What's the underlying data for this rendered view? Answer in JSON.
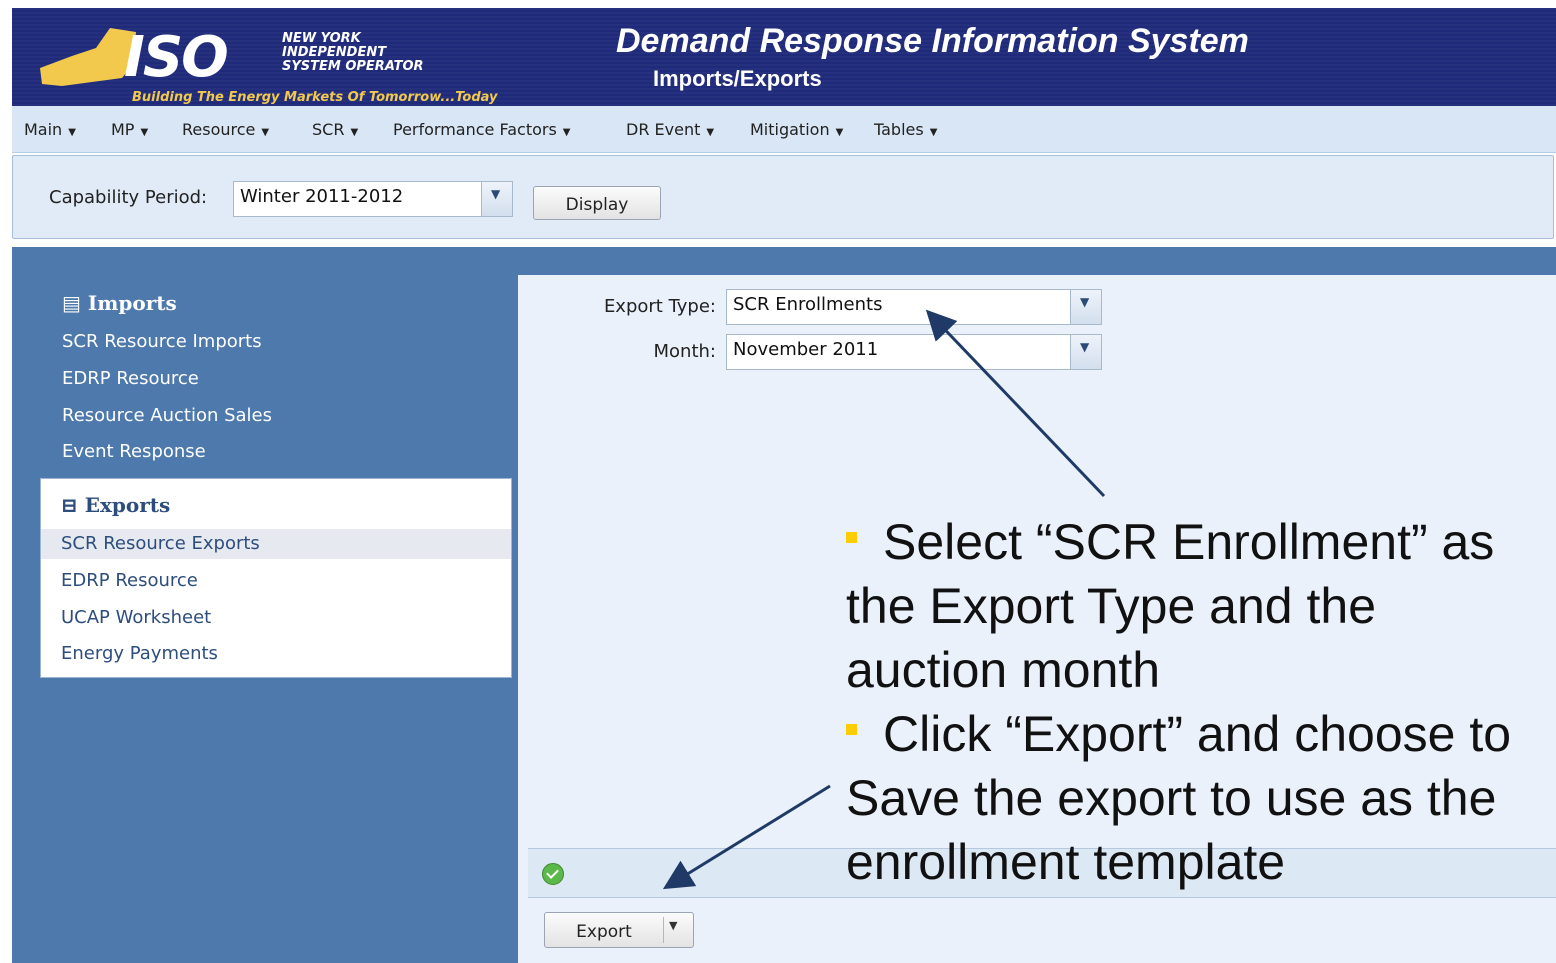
{
  "header": {
    "org_line1": "NEW YORK",
    "org_line2": "INDEPENDENT",
    "org_line3": "SYSTEM OPERATOR",
    "logo_text": "ISO",
    "tagline": "Building The Energy Markets Of Tomorrow...Today",
    "app_title": "Demand Response Information System",
    "page_title": "Imports/Exports"
  },
  "menu": {
    "items": [
      "Main",
      "MP",
      "Resource",
      "SCR",
      "Performance Factors",
      "DR Event",
      "Mitigation",
      "Tables"
    ]
  },
  "filter": {
    "label": "Capability Period:",
    "value": "Winter 2011-2012",
    "button": "Display"
  },
  "sidebar": {
    "imports_heading": "Imports",
    "imports": [
      "SCR Resource Imports",
      "EDRP Resource",
      "Resource Auction Sales",
      "Event Response"
    ],
    "exports_heading": "Exports",
    "exports": [
      "SCR Resource Exports",
      "EDRP Resource",
      "UCAP Worksheet",
      "Energy Payments"
    ],
    "selected_export_index": 0
  },
  "form": {
    "export_type_label": "Export Type:",
    "export_type_value": "SCR Enrollments",
    "month_label": "Month:",
    "month_value": "November 2011",
    "export_button": "Export"
  },
  "callout": {
    "bullet1": "Select “SCR Enrollment” as the Export Type and the auction month",
    "bullet2": "Click “Export” and choose to Save the export to use as the enrollment template"
  },
  "colors": {
    "header_bg": "#1f2a7a",
    "panel_blue": "#4d79ac",
    "bullet": "#ffcc00",
    "arrow": "#1f3a66"
  }
}
